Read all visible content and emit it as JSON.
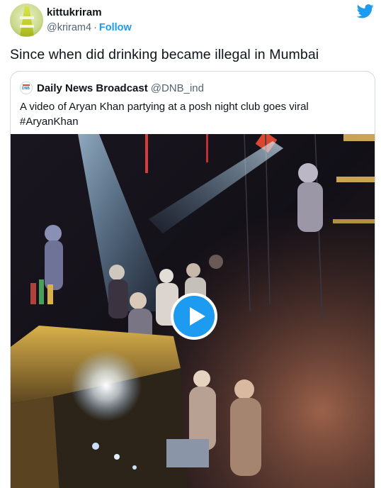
{
  "author": {
    "name": "kittukriram",
    "handle": "@kriram4",
    "separator": "·",
    "follow_label": "Follow",
    "avatar_icon": "traffic-cone-avatar"
  },
  "brand_icon": "twitter-bird-icon",
  "tweet": {
    "text": "Since when did drinking became illegal in Mumbai"
  },
  "quoted": {
    "logo_icon": "dnb-logo",
    "logo_text": "DNB",
    "name": "Daily News Broadcast",
    "handle": "@DNB_ind",
    "text_line1": "A video of Aryan Khan partying at a posh night club goes viral",
    "text_line2": "#AryanKhan",
    "media": {
      "type": "video",
      "play_icon": "play-icon"
    }
  },
  "colors": {
    "accent": "#1d9bf0",
    "text": "#0f1419",
    "muted": "#536471",
    "border": "#cfd9de"
  }
}
